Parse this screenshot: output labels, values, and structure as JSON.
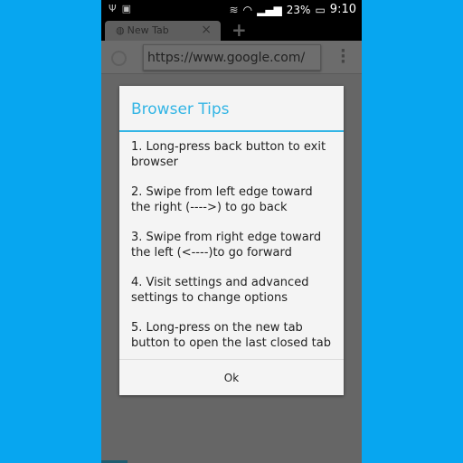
{
  "status_bar": {
    "left_icons": [
      "usb-icon",
      "android-icon"
    ],
    "battery": "23%",
    "time": "9:10",
    "icons": [
      "vibrate-icon",
      "wifi-icon",
      "signal-icon",
      "battery-icon"
    ]
  },
  "browser": {
    "tab_title": "New Tab",
    "url": "https://www.google.com/"
  },
  "dialog": {
    "title": "Browser Tips",
    "tips": [
      "1. Long-press back button to exit browser",
      "2. Swipe from left edge toward the right (---->) to go back",
      "3. Swipe from right edge toward the left (<----)to go forward",
      "4. Visit settings and advanced settings to change options",
      "5. Long-press on the new tab button to open the last closed tab"
    ],
    "ok_label": "Ok"
  },
  "colors": {
    "accent": "#33b5e5",
    "background": "#07a6f0"
  }
}
